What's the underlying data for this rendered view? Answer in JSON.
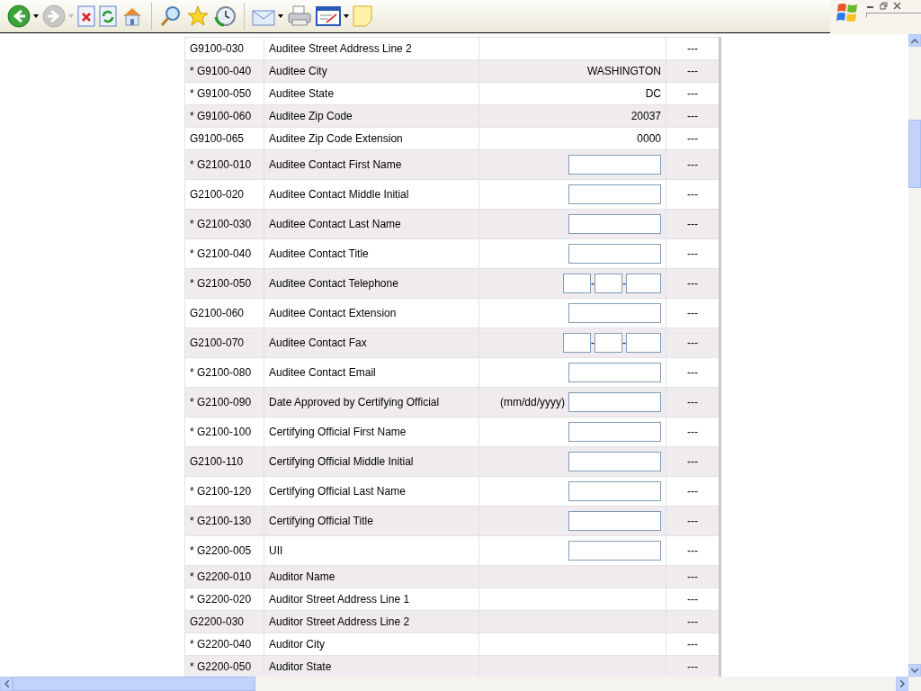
{
  "toolbar": {
    "buttons": [
      {
        "kind": "back",
        "disabled": false,
        "menu": true
      },
      {
        "kind": "forward",
        "disabled": true,
        "menu": true
      },
      {
        "kind": "stop",
        "disabled": false,
        "menu": false
      },
      {
        "kind": "refresh",
        "disabled": false,
        "menu": false
      },
      {
        "kind": "home",
        "disabled": false,
        "menu": false
      },
      {
        "kind": "separator"
      },
      {
        "kind": "search",
        "disabled": false,
        "menu": false
      },
      {
        "kind": "favorites",
        "disabled": false,
        "menu": false
      },
      {
        "kind": "history",
        "disabled": false,
        "menu": false
      },
      {
        "kind": "separator"
      },
      {
        "kind": "mail",
        "disabled": false,
        "menu": true
      },
      {
        "kind": "print",
        "disabled": false,
        "menu": false
      },
      {
        "kind": "edit",
        "disabled": false,
        "menu": true
      },
      {
        "kind": "note",
        "disabled": false,
        "menu": false
      }
    ]
  },
  "form": {
    "rows": [
      {
        "code": "G9100-030",
        "label": "Auditee Street Address Line 2",
        "kind": "text",
        "value": "",
        "status": "---"
      },
      {
        "code": "* G9100-040",
        "label": "Auditee City",
        "kind": "text",
        "value": "WASHINGTON",
        "status": "---"
      },
      {
        "code": "* G9100-050",
        "label": "Auditee State",
        "kind": "text",
        "value": "DC",
        "status": "---"
      },
      {
        "code": "* G9100-060",
        "label": "Auditee Zip Code",
        "kind": "text",
        "value": "20037",
        "status": "---"
      },
      {
        "code": "G9100-065",
        "label": "Auditee Zip Code Extension",
        "kind": "text",
        "value": "0000",
        "status": "---"
      },
      {
        "code": "* G2100-010",
        "label": "Auditee Contact First Name",
        "kind": "input",
        "status": "---"
      },
      {
        "code": "G2100-020",
        "label": "Auditee Contact Middle Initial",
        "kind": "input",
        "status": "---"
      },
      {
        "code": "* G2100-030",
        "label": "Auditee Contact Last Name",
        "kind": "input",
        "status": "---"
      },
      {
        "code": "* G2100-040",
        "label": "Auditee Contact Title",
        "kind": "input",
        "status": "---"
      },
      {
        "code": "* G2100-050",
        "label": "Auditee Contact Telephone",
        "kind": "phone",
        "separators": [
          "-",
          "-"
        ],
        "status": "---"
      },
      {
        "code": "G2100-060",
        "label": "Auditee Contact Extension",
        "kind": "input",
        "status": "---"
      },
      {
        "code": "G2100-070",
        "label": "Auditee Contact Fax",
        "kind": "phone",
        "separators": [
          "-",
          "-"
        ],
        "status": "---"
      },
      {
        "code": "* G2100-080",
        "label": "Auditee Contact Email",
        "kind": "input",
        "status": "---"
      },
      {
        "code": "* G2100-090",
        "label": "Date Approved by Certifying Official",
        "kind": "date",
        "hint": "(mm/dd/yyyy)",
        "status": "---"
      },
      {
        "code": "* G2100-100",
        "label": "Certifying Official First Name",
        "kind": "input",
        "status": "---"
      },
      {
        "code": "G2100-110",
        "label": "Certifying Official Middle Initial",
        "kind": "input",
        "status": "---"
      },
      {
        "code": "* G2100-120",
        "label": "Certifying Official Last Name",
        "kind": "input",
        "status": "---"
      },
      {
        "code": "* G2100-130",
        "label": "Certifying Official Title",
        "kind": "input",
        "status": "---"
      },
      {
        "code": "* G2200-005",
        "label": "UII",
        "kind": "input",
        "status": "---"
      },
      {
        "code": "* G2200-010",
        "label": "Auditor Name",
        "kind": "text",
        "value": "",
        "status": "---"
      },
      {
        "code": "* G2200-020",
        "label": "Auditor Street Address Line 1",
        "kind": "text",
        "value": "",
        "status": "---"
      },
      {
        "code": "G2200-030",
        "label": "Auditor Street Address Line 2",
        "kind": "text",
        "value": "",
        "status": "---"
      },
      {
        "code": "* G2200-040",
        "label": "Auditor City",
        "kind": "text",
        "value": "",
        "status": "---"
      },
      {
        "code": "* G2200-050",
        "label": "Auditor State",
        "kind": "text",
        "value": "",
        "status": "---"
      }
    ]
  }
}
